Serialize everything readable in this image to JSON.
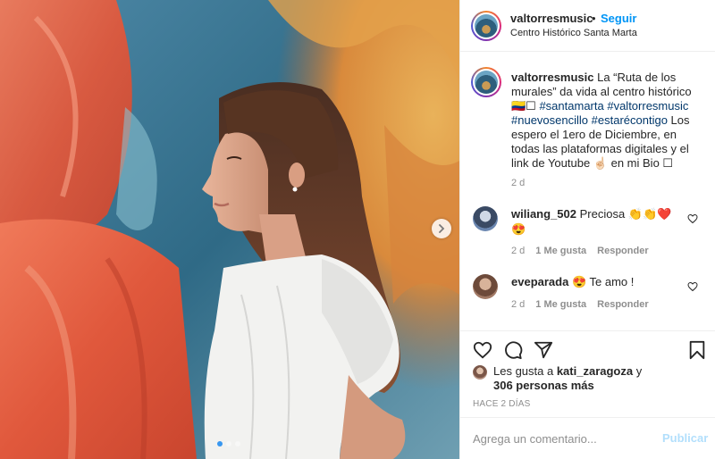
{
  "post": {
    "username": "valtorresmusic",
    "separator": "•",
    "follow_label": "Seguir",
    "location": "Centro Histórico Santa Marta",
    "caption": {
      "username": "valtorresmusic",
      "part1": " La “Ruta de los murales” da vida al centro histórico 🇨🇴☐ ",
      "tag1": "#santamarta",
      "tag2": "#valtorresmusic",
      "tag3": "#nuevosencillo",
      "tag4": "#estarécontigo",
      "part2": " Los espero el 1ero de Diciembre, en todas las plataformas digitales y el link de Youtube ☝🏻 en mi Bio ☐",
      "time": "2 d"
    },
    "comments": [
      {
        "username": "wiliang_502",
        "text": " Preciosa 👏👏❤️😍",
        "time": "2 d",
        "likes": "1 Me gusta",
        "reply": "Responder"
      },
      {
        "username": "eveparada",
        "text": " 😍  Te amo !",
        "time": "2 d",
        "likes": "1 Me gusta",
        "reply": "Responder"
      }
    ],
    "likes": {
      "prefix": "Les gusta a ",
      "user": "kati_zaragoza",
      "mid": " y",
      "others": "306 personas más"
    },
    "timestamp": "HACE 2 DÍAS",
    "add_comment": {
      "placeholder": "Agrega un comentario...",
      "post_label": "Publicar"
    },
    "carousel": {
      "count": 3,
      "active_index": 0
    }
  },
  "icons": {
    "next": "chevron-right-icon",
    "like": "heart-icon",
    "comment": "comment-icon",
    "share": "paper-plane-icon",
    "save": "bookmark-icon"
  },
  "colors": {
    "follow": "#0095f6",
    "hashtag": "#00376b",
    "muted": "#8e8e8e",
    "post_disabled": "#b2dffc",
    "carousel_active": "#3897f0"
  }
}
